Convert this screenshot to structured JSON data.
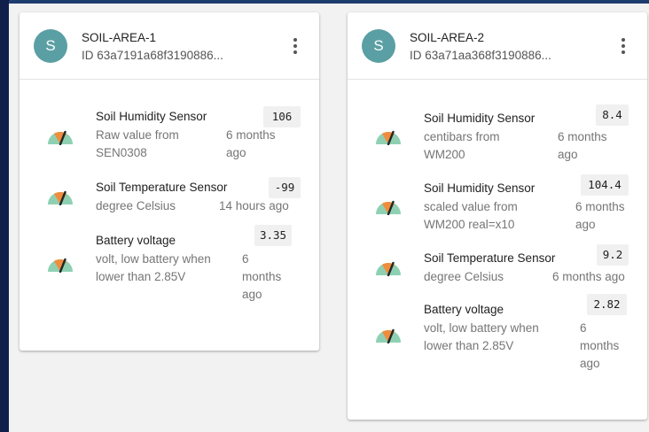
{
  "devices": [
    {
      "avatar_letter": "S",
      "name": "SOIL-AREA-1",
      "id": "ID 63a7191a68f3190886...",
      "sensors": [
        {
          "title": "Soil Humidity Sensor",
          "value": "106",
          "unit_lines": [
            "Raw value from",
            "SEN0308"
          ],
          "time_lines": [
            "6 months",
            "ago"
          ]
        },
        {
          "title": "Soil Temperature Sensor",
          "value": "-99",
          "unit_lines": [
            "degree Celsius"
          ],
          "time_lines": [
            "14 hours ago"
          ]
        },
        {
          "title": "Battery voltage",
          "value": "3.35",
          "unit_lines": [
            "volt, low battery when",
            "lower than 2.85V"
          ],
          "time_lines": [
            "6",
            "months",
            "ago"
          ]
        }
      ]
    },
    {
      "avatar_letter": "S",
      "name": "SOIL-AREA-2",
      "id": "ID 63a71aa368f3190886...",
      "sensors": [
        {
          "title": "Soil Humidity Sensor",
          "value": "8.4",
          "unit_lines": [
            "centibars from",
            "WM200"
          ],
          "time_lines": [
            "6 months",
            "ago"
          ]
        },
        {
          "title": "Soil Humidity Sensor",
          "value": "104.4",
          "unit_lines": [
            "scaled value from",
            "WM200 real=x10"
          ],
          "time_lines": [
            "6 months",
            "ago"
          ]
        },
        {
          "title": "Soil Temperature Sensor",
          "value": "9.2",
          "unit_lines": [
            "degree Celsius"
          ],
          "time_lines": [
            "6 months ago"
          ]
        },
        {
          "title": "Battery voltage",
          "value": "2.82",
          "unit_lines": [
            "volt, low battery when",
            "lower than 2.85V"
          ],
          "time_lines": [
            "6",
            "months",
            "ago"
          ]
        }
      ]
    }
  ],
  "colors": {
    "avatar": "#5a9fa3",
    "gauge_low": "#8fd0b3",
    "gauge_high": "#f08c3c",
    "background": "#f2f2f2"
  },
  "icons": {
    "menu": "more-vert-icon",
    "sensor": "gauge-icon"
  }
}
